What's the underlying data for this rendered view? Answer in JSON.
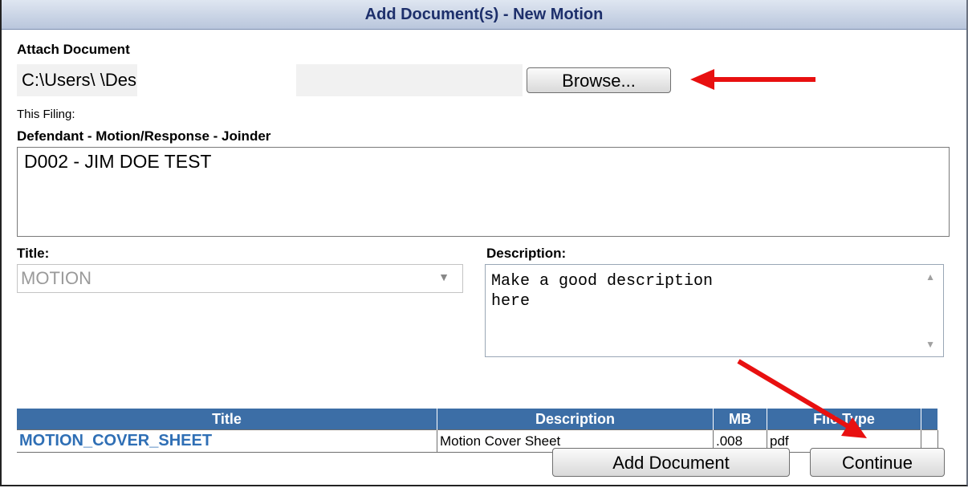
{
  "dialog": {
    "title": "Add Document(s) - New Motion"
  },
  "attach": {
    "label": "Attach Document",
    "file_path": "C:\\Users\\                               \\Desktop\\Microsoft Wo",
    "browse_label": "Browse..."
  },
  "filing": {
    "label": "This Filing:",
    "type_label": "Defendant - Motion/Response - Joinder",
    "parties": [
      "D002 - JIM DOE TEST"
    ]
  },
  "title_field": {
    "label": "Title:",
    "value": "MOTION"
  },
  "description_field": {
    "label": "Description:",
    "value": "Make a good description\nhere"
  },
  "table": {
    "headers": [
      "Title",
      "Description",
      "MB",
      "File Type"
    ],
    "rows": [
      [
        "MOTION_COVER_SHEET",
        "Motion Cover Sheet",
        ".008",
        "pdf"
      ]
    ]
  },
  "buttons": {
    "add_document": "Add Document",
    "continue": "Continue"
  },
  "annotation_color": "#e81010"
}
